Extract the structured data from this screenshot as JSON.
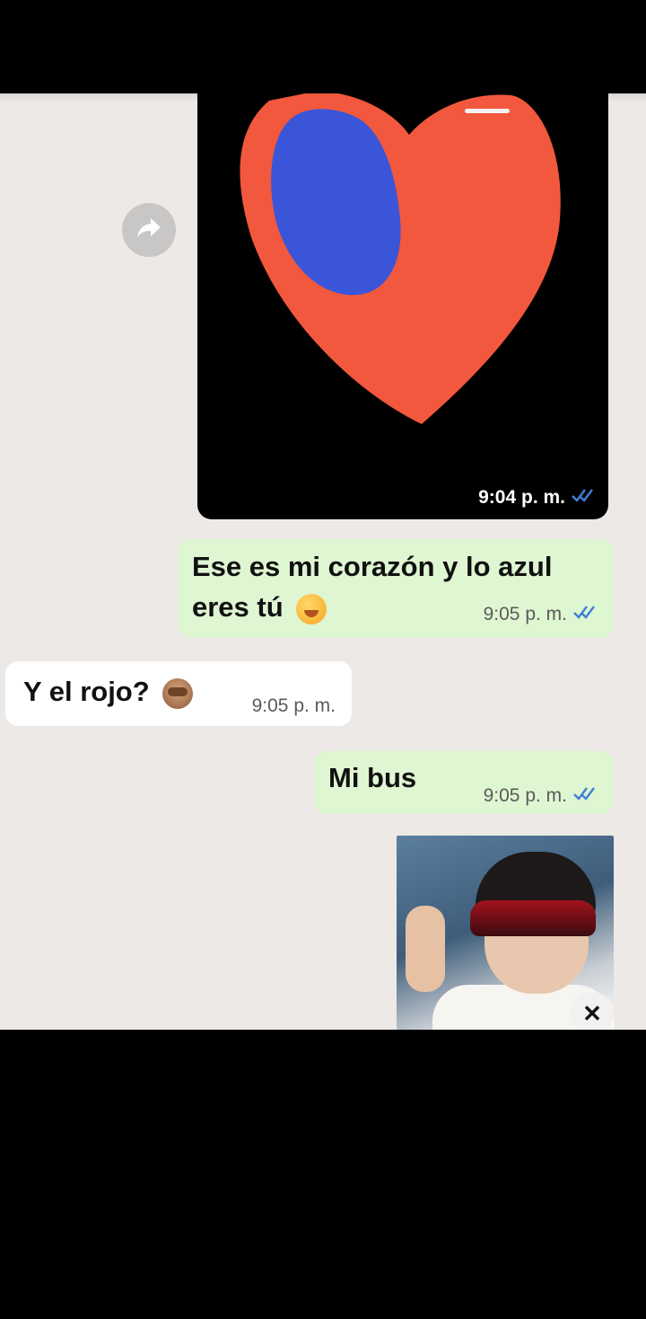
{
  "messages": [
    {
      "type": "image",
      "direction": "outgoing",
      "time": "9:04 p. m.",
      "status": "read"
    },
    {
      "type": "text",
      "direction": "outgoing",
      "text": "Ese es mi corazón y lo azul eres tú",
      "emoji": "grinning-face-with-hand-over-mouth",
      "time": "9:05 p. m.",
      "status": "read"
    },
    {
      "type": "text",
      "direction": "incoming",
      "text": "Y el rojo?",
      "emoji": "see-no-evil-monkey",
      "time": "9:05 p. m."
    },
    {
      "type": "text",
      "direction": "outgoing",
      "text": "Mi bus",
      "time": "9:05 p. m.",
      "status": "read"
    },
    {
      "type": "image",
      "direction": "outgoing",
      "content": "photo-child-sunglasses"
    }
  ],
  "colors": {
    "outgoing_bubble": "#dff6d2",
    "incoming_bubble": "#ffffff",
    "chat_background": "#ece9e6",
    "read_ticks": "#3f7fd8",
    "heart_red": "#f2583d",
    "heart_blue": "#3a55d8"
  },
  "icons": [
    "forward-icon",
    "double-check-icon",
    "close-icon"
  ]
}
